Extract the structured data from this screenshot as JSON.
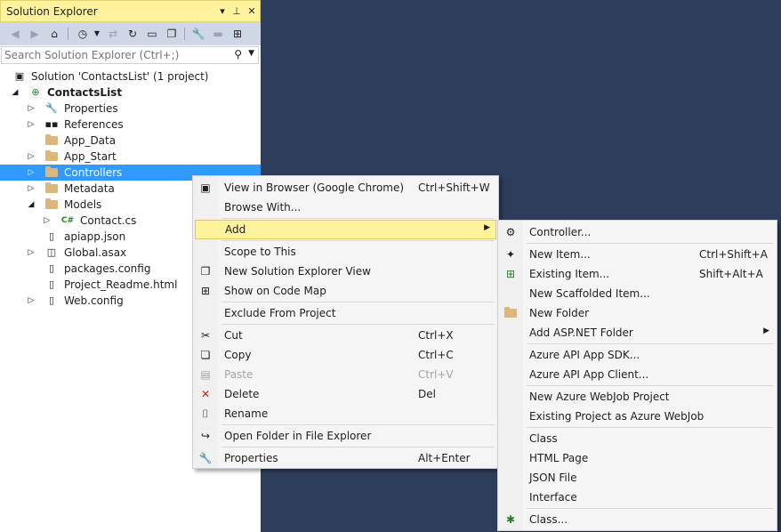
{
  "explorer": {
    "title": "Solution Explorer",
    "title_buttons": {
      "dropdown": "▾",
      "pin": "⊥",
      "close": "✕"
    },
    "search_placeholder": "Search Solution Explorer (Ctrl+;)",
    "tree": [
      {
        "label": "Solution 'ContactsList' (1 project)",
        "icon": "solution-icon"
      },
      {
        "label": "ContactsList",
        "icon": "web-project-icon",
        "bold": true,
        "expanded": true
      },
      {
        "label": "Properties",
        "icon": "wrench-icon"
      },
      {
        "label": "References",
        "icon": "references-icon"
      },
      {
        "label": "App_Data",
        "icon": "folder-icon"
      },
      {
        "label": "App_Start",
        "icon": "folder-icon"
      },
      {
        "label": "Controllers",
        "icon": "folder-icon",
        "selected": true
      },
      {
        "label": "Metadata",
        "icon": "folder-icon"
      },
      {
        "label": "Models",
        "icon": "folder-icon",
        "expanded": true
      },
      {
        "label": "Contact.cs",
        "icon": "csharp-file-icon"
      },
      {
        "label": "apiapp.json",
        "icon": "json-file-icon"
      },
      {
        "label": "Global.asax",
        "icon": "asax-file-icon"
      },
      {
        "label": "packages.config",
        "icon": "config-file-icon"
      },
      {
        "label": "Project_Readme.html",
        "icon": "html-file-icon"
      },
      {
        "label": "Web.config",
        "icon": "config-file-icon"
      }
    ]
  },
  "context_menu": {
    "items": [
      {
        "label": "View in Browser (Google Chrome)",
        "shortcut": "Ctrl+Shift+W",
        "icon": "browser-icon"
      },
      {
        "label": "Browse With...",
        "shortcut": ""
      },
      {
        "label": "Add",
        "shortcut": "",
        "submenu": true,
        "highlighted": true
      },
      {
        "label": "Scope to This",
        "shortcut": ""
      },
      {
        "label": "New Solution Explorer View",
        "shortcut": "",
        "icon": "new-view-icon"
      },
      {
        "label": "Show on Code Map",
        "shortcut": "",
        "icon": "code-map-icon"
      },
      {
        "label": "Exclude From Project",
        "shortcut": ""
      },
      {
        "label": "Cut",
        "shortcut": "Ctrl+X",
        "icon": "cut-icon"
      },
      {
        "label": "Copy",
        "shortcut": "Ctrl+C",
        "icon": "copy-icon"
      },
      {
        "label": "Paste",
        "shortcut": "Ctrl+V",
        "icon": "paste-icon",
        "disabled": true
      },
      {
        "label": "Delete",
        "shortcut": "Del",
        "icon": "delete-icon"
      },
      {
        "label": "Rename",
        "shortcut": "",
        "icon": "rename-icon"
      },
      {
        "label": "Open Folder in File Explorer",
        "shortcut": "",
        "icon": "open-folder-icon"
      },
      {
        "label": "Properties",
        "shortcut": "Alt+Enter",
        "icon": "wrench-icon"
      }
    ]
  },
  "add_submenu": {
    "items": [
      {
        "label": "Controller...",
        "shortcut": "",
        "icon": "controller-icon"
      },
      {
        "label": "New Item...",
        "shortcut": "Ctrl+Shift+A",
        "icon": "new-item-icon"
      },
      {
        "label": "Existing Item...",
        "shortcut": "Shift+Alt+A",
        "icon": "existing-item-icon"
      },
      {
        "label": "New Scaffolded Item...",
        "shortcut": ""
      },
      {
        "label": "New Folder",
        "shortcut": "",
        "icon": "new-folder-icon"
      },
      {
        "label": "Add ASP.NET Folder",
        "shortcut": "",
        "submenu": true
      },
      {
        "label": "Azure API App SDK...",
        "shortcut": ""
      },
      {
        "label": "Azure API App Client...",
        "shortcut": ""
      },
      {
        "label": "New Azure WebJob Project",
        "shortcut": ""
      },
      {
        "label": "Existing Project as Azure WebJob",
        "shortcut": ""
      },
      {
        "label": "Class",
        "shortcut": ""
      },
      {
        "label": "HTML Page",
        "shortcut": ""
      },
      {
        "label": "JSON File",
        "shortcut": ""
      },
      {
        "label": "Interface",
        "shortcut": ""
      },
      {
        "label": "Class...",
        "shortcut": "",
        "icon": "class-wizard-icon"
      }
    ]
  },
  "colors": {
    "background": "#2e3d5b",
    "title_bar": "#fff29d",
    "selection": "#3399ff",
    "menu_highlight": "#fff29d"
  }
}
